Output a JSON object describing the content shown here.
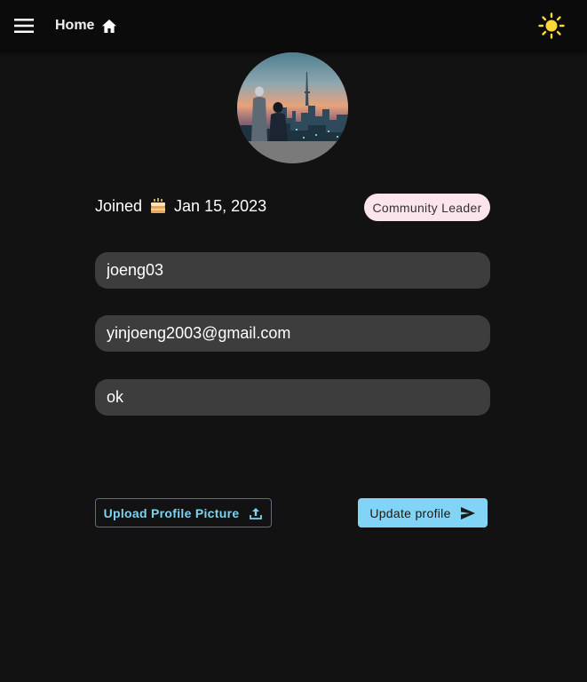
{
  "app": {
    "nav": {
      "home_label": "Home",
      "menu_icon": "hamburger-menu-icon",
      "home_icon": "home-icon",
      "theme_icon": "sun-icon"
    }
  },
  "profile": {
    "avatar_description": "profile-avatar",
    "joined_label": "Joined",
    "joined_icon": "birthday-cake-icon",
    "joined_date": "Jan 15, 2023",
    "role_badge": "Community Leader"
  },
  "form": {
    "username": "joeng03",
    "email": "yinjoeng2003@gmail.com",
    "bio": "ok"
  },
  "actions": {
    "upload_label": "Upload Profile Picture",
    "upload_icon": "upload-icon",
    "update_label": "Update profile",
    "update_icon": "send-icon"
  },
  "colors": {
    "background": "#121212",
    "appbar": "#0b0b0b",
    "field": "#3d3d3d",
    "accent": "#81d4f5",
    "badge": "#fce4ec",
    "sun": "#fdd835"
  }
}
